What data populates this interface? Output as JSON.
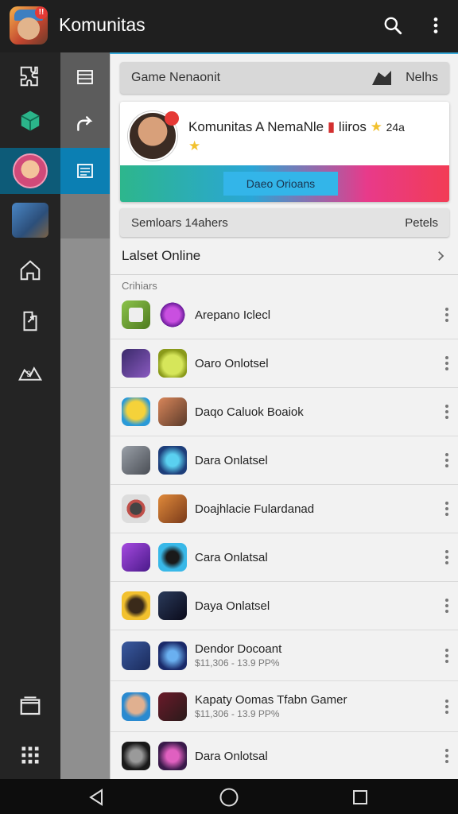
{
  "app_bar": {
    "title": "Komunitas",
    "app_icon": "game-character-app-icon",
    "badge": "!!"
  },
  "header_card": {
    "label": "Game Nenaonit",
    "right_label": "Nelhs",
    "icon": "tag-icon"
  },
  "profile": {
    "name": "Komunitas A NemaNle",
    "extra": "liiros",
    "score": "24a",
    "stars": "★ ★"
  },
  "cta_button": {
    "label": "Daeo Orioans"
  },
  "stats_card": {
    "label": "Semloars 14ahers",
    "right_label": "Petels"
  },
  "latest": {
    "label": "Lalset Online"
  },
  "section_label": "Crihiars",
  "games": [
    {
      "title": "Arepano Iclecl",
      "sub": ""
    },
    {
      "title": "Oaro Onlotsel",
      "sub": ""
    },
    {
      "title": "Daqo Caluok Boaiok",
      "sub": ""
    },
    {
      "title": "Dara Onlatsel",
      "sub": ""
    },
    {
      "title": "Doajhlacie Fulardanad",
      "sub": ""
    },
    {
      "title": "Cara Onlatsal",
      "sub": ""
    },
    {
      "title": "Daya Onlatsel",
      "sub": ""
    },
    {
      "title": "Dendor Docoant",
      "sub": "$11,306 - 13.9 PP%"
    },
    {
      "title": "Kapaty Oomas Tfabn Gamer",
      "sub": "$11,306 - 13.9 PP%"
    },
    {
      "title": "Dara Onlotsal",
      "sub": ""
    }
  ],
  "colors": {
    "accent": "#0b7fb3",
    "gradient_start": "#2db68c",
    "gradient_end": "#f23c55"
  }
}
